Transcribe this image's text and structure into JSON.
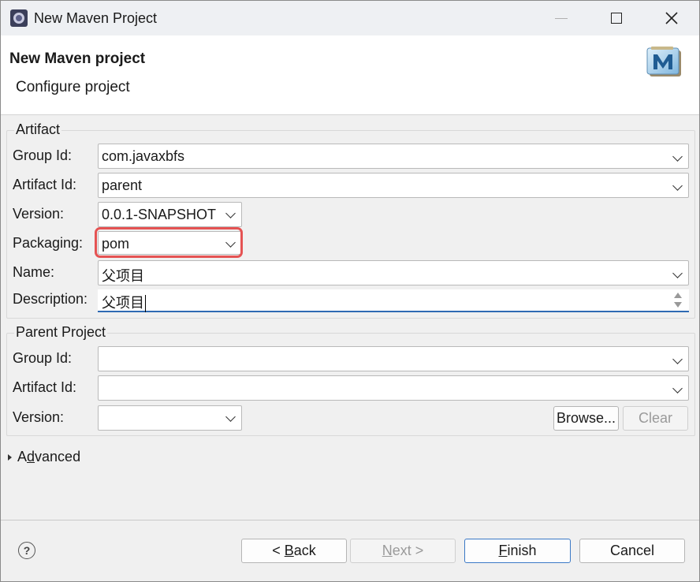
{
  "window": {
    "title": "New Maven Project"
  },
  "header": {
    "title": "New Maven project",
    "subtitle": "Configure project"
  },
  "artifact": {
    "group_title": "Artifact",
    "group_id_label": "Group Id:",
    "group_id_value": "com.javaxbfs",
    "artifact_id_label": "Artifact Id:",
    "artifact_id_value": "parent",
    "version_label": "Version:",
    "version_value": "0.0.1-SNAPSHOT",
    "packaging_label": "Packaging:",
    "packaging_value": "pom",
    "name_label": "Name:",
    "name_value": "父项目",
    "description_label": "Description:",
    "description_value": "父项目"
  },
  "parent_project": {
    "group_title": "Parent Project",
    "group_id_label": "Group Id:",
    "group_id_value": "",
    "artifact_id_label": "Artifact Id:",
    "artifact_id_value": "",
    "version_label": "Version:",
    "version_value": "",
    "browse_button": "Browse...",
    "clear_button": "Clear"
  },
  "advanced": {
    "label_pre": "A",
    "label_mnemonic": "d",
    "label_post": "vanced"
  },
  "footer": {
    "back_pre": "< ",
    "back_mnemonic": "B",
    "back_post": "ack",
    "next_mnemonic": "N",
    "next_post": "ext >",
    "finish_mnemonic": "F",
    "finish_post": "inish",
    "cancel": "Cancel"
  },
  "icons": {
    "app": "eclipse-icon",
    "help": "help-icon",
    "maven": "maven-logo"
  },
  "colors": {
    "highlight": "#e55353",
    "focus": "#2e6ab3",
    "default_button_border": "#3b79c6"
  }
}
